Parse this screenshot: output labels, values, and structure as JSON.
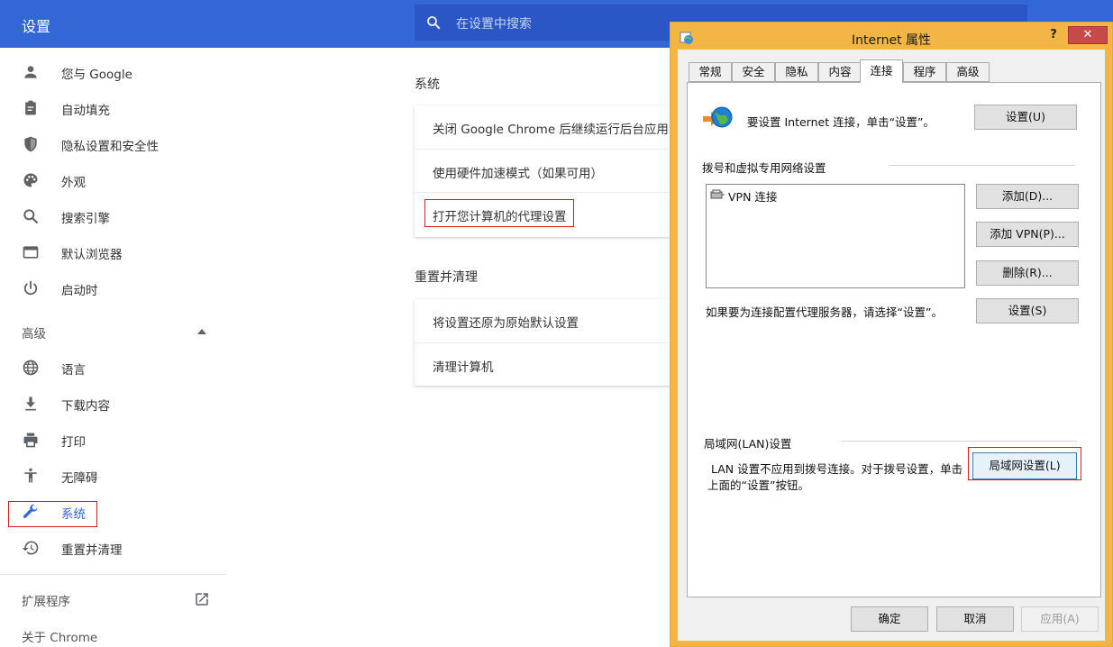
{
  "chrome": {
    "title": "设置",
    "search_placeholder": "在设置中搜索"
  },
  "sidebar": {
    "items": [
      {
        "label": "您与 Google",
        "icon": "person-icon"
      },
      {
        "label": "自动填充",
        "icon": "clipboard-icon"
      },
      {
        "label": "隐私设置和安全性",
        "icon": "shield-icon"
      },
      {
        "label": "外观",
        "icon": "palette-icon"
      },
      {
        "label": "搜索引擎",
        "icon": "search-icon"
      },
      {
        "label": "默认浏览器",
        "icon": "browser-icon"
      },
      {
        "label": "启动时",
        "icon": "power-icon"
      }
    ],
    "advanced_label": "高级",
    "advanced_items": [
      {
        "label": "语言",
        "icon": "globe-icon"
      },
      {
        "label": "下载内容",
        "icon": "download-icon"
      },
      {
        "label": "打印",
        "icon": "printer-icon"
      },
      {
        "label": "无障碍",
        "icon": "accessibility-icon"
      },
      {
        "label": "系统",
        "icon": "wrench-icon"
      },
      {
        "label": "重置并清理",
        "icon": "history-icon"
      }
    ],
    "extensions_label": "扩展程序",
    "about_label": "关于 Chrome"
  },
  "content": {
    "system_title": "系统",
    "system_rows": [
      "关闭 Google Chrome 后继续运行后台应用",
      "使用硬件加速模式（如果可用）",
      "打开您计算机的代理设置"
    ],
    "reset_title": "重置并清理",
    "reset_rows": [
      "将设置还原为原始默认设置",
      "清理计算机"
    ]
  },
  "dialog": {
    "title": "Internet 属性",
    "help": "?",
    "close": "✕",
    "tabs": [
      "常规",
      "安全",
      "隐私",
      "内容",
      "连接",
      "程序",
      "高级"
    ],
    "active_tab": "连接",
    "setup_text": "要设置 Internet 连接，单击“设置”。",
    "setup_button": "设置(U)",
    "dialup_group": "拨号和虚拟专用网络设置",
    "vpn_entry": "VPN 连接",
    "add_button": "添加(D)...",
    "add_vpn_button": "添加 VPN(P)...",
    "delete_button": "删除(R)...",
    "proxy_text": "如果要为连接配置代理服务器，请选择“设置”。",
    "settings_button": "设置(S)",
    "lan_group": "局域网(LAN)设置",
    "lan_text_1": "LAN 设置不应用到拨号连接。对于拨号设置，单击",
    "lan_text_2": "上面的“设置”按钮。",
    "lan_button": "局域网设置(L)",
    "ok_button": "确定",
    "cancel_button": "取消",
    "apply_button": "应用(A)"
  },
  "colors": {
    "chrome_blue": "#3367d6",
    "highlight_red": "#d61c1c",
    "dialog_frame": "#f3b644",
    "close_red": "#c74a4a"
  }
}
